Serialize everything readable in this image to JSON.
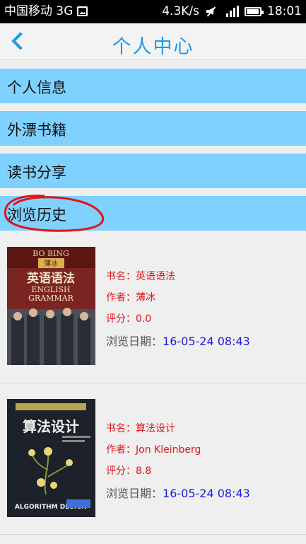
{
  "status_bar": {
    "carrier": "中国移动 3G",
    "speed": "4.3K/s",
    "time": "18:01",
    "icons": [
      "image-icon",
      "mute-icon",
      "signal-icon",
      "battery-icon"
    ]
  },
  "header": {
    "title": "个人中心",
    "back_icon": "chevron-left-icon"
  },
  "menu": {
    "items": [
      {
        "label": "个人信息"
      },
      {
        "label": "外漂书籍"
      },
      {
        "label": "读书分享"
      },
      {
        "label": "浏览历史"
      }
    ]
  },
  "books": [
    {
      "title_label": "书名：",
      "title": "英语语法",
      "author_label": "作者：",
      "author": "薄冰",
      "rating_label": "评分：",
      "rating": "0.0",
      "date_label": "浏览日期：",
      "date": "16-05-24 08:43",
      "cover_top": "BO BING",
      "cover_seal": "薄冰",
      "cover_title": "英语语法",
      "cover_en_1": "ENGLISH",
      "cover_en_2": "GRAMMAR"
    },
    {
      "title_label": "书名：",
      "title": "算法设计",
      "author_label": "作者：",
      "author": "Jon Kleinberg",
      "rating_label": "评分：",
      "rating": "8.8",
      "date_label": "浏览日期：",
      "date": "16-05-24 08:43",
      "cover_title": "算法设计",
      "cover_en": "ALGORITHM DESIGN"
    }
  ],
  "colors": {
    "accent": "#1e9be9",
    "menu_bg": "#7fd1ff",
    "book_text": "#e3131b",
    "date_value": "#1a1ae0",
    "annotation": "#e3131b"
  }
}
